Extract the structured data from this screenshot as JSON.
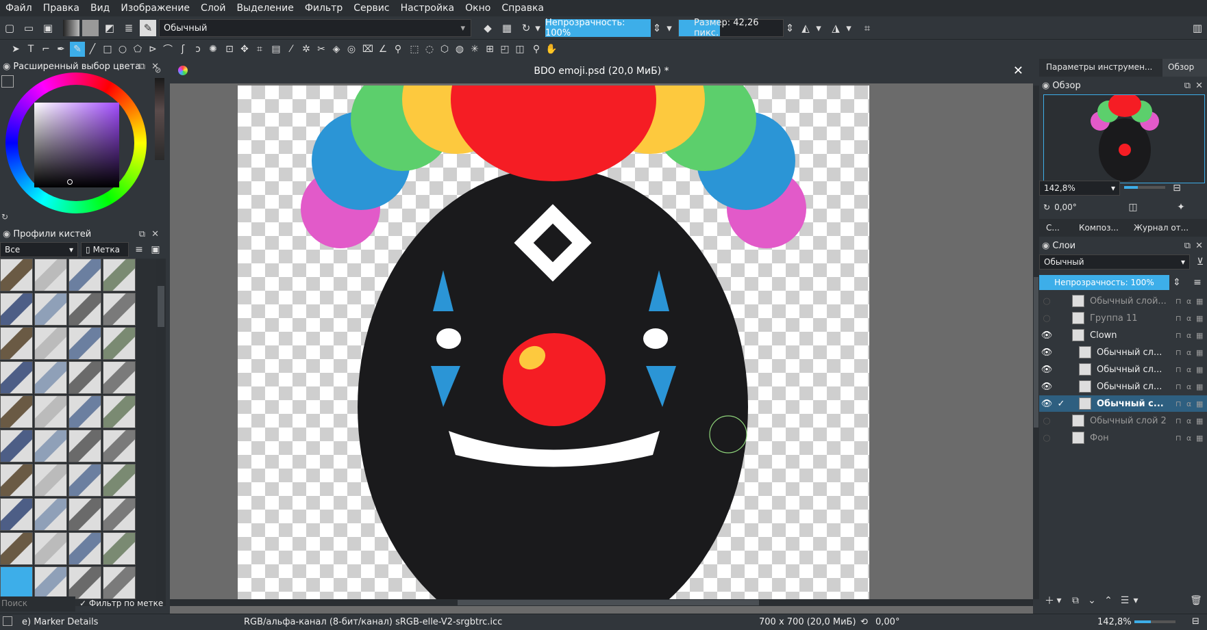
{
  "menu": [
    "Файл",
    "Правка",
    "Вид",
    "Изображение",
    "Слой",
    "Выделение",
    "Фильтр",
    "Сервис",
    "Настройка",
    "Окно",
    "Справка"
  ],
  "toolbar": {
    "blend_mode": "Обычный",
    "opacity_label": "Непрозрачность: 100%",
    "size_label": "Размер: 42,26 пикс."
  },
  "left_dock": {
    "color_title": "Расширенный выбор цвета",
    "brush_title": "Профили кистей",
    "brush_filter": "Все",
    "brush_tag": "Метка",
    "search_placeholder": "Поиск",
    "filter_by_tag": "Фильтр по метке"
  },
  "document": {
    "title": "BDO emoji.psd (20,0 МиБ) *"
  },
  "right_dock": {
    "tabs": [
      "Параметры инструмен...",
      "Обзор"
    ],
    "overview_title": "Обзор",
    "zoom": "142,8%",
    "rotation": "0,00°",
    "bottom_tabs": [
      "С...",
      "Композ...",
      "Журнал от..."
    ],
    "layers_title": "Слои",
    "blend_mode": "Обычный",
    "opacity": "Непрозрачность: 100%",
    "layers": [
      {
        "name": "Обычный слой...",
        "visible": false,
        "bold": false
      },
      {
        "name": "Группа 11",
        "visible": false,
        "bold": false
      },
      {
        "name": "Clown",
        "visible": true,
        "bold": false
      },
      {
        "name": "Обычный сл...",
        "visible": true,
        "bold": false
      },
      {
        "name": "Обычный сл...",
        "visible": true,
        "bold": false
      },
      {
        "name": "Обычный сл...",
        "visible": true,
        "bold": false
      },
      {
        "name": "Обычный с...",
        "visible": true,
        "bold": true
      },
      {
        "name": "Обычный слой 2",
        "visible": false,
        "bold": false
      },
      {
        "name": "Фон",
        "visible": false,
        "bold": false
      }
    ]
  },
  "status": {
    "brush": "e) Marker Details",
    "color_space": "RGB/альфа-канал (8-бит/канал)  sRGB-elle-V2-srgbtrc.icc",
    "dimensions": "700 x 700 (20,0 МиБ)",
    "rotation": "0,00°",
    "zoom": "142,8%"
  },
  "colors": {
    "accent": "#3daee9",
    "panel": "#31363b",
    "canvas_bg": "#6b6b6b"
  }
}
